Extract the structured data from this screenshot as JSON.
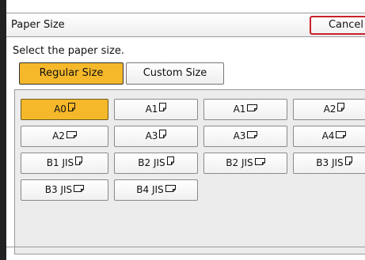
{
  "window": {
    "title": "Paper Size",
    "cancel_label": "Cancel"
  },
  "instruction": "Select the paper size.",
  "tabs": [
    {
      "label": "Regular Size",
      "active": true
    },
    {
      "label": "Custom Size",
      "active": false
    }
  ],
  "sizes": [
    {
      "label": "A0",
      "orientation": "portrait",
      "selected": true
    },
    {
      "label": "A1",
      "orientation": "portrait",
      "selected": false
    },
    {
      "label": "A1",
      "orientation": "landscape",
      "selected": false
    },
    {
      "label": "A2",
      "orientation": "portrait",
      "selected": false
    },
    {
      "label": "A2",
      "orientation": "landscape",
      "selected": false
    },
    {
      "label": "A3",
      "orientation": "portrait",
      "selected": false
    },
    {
      "label": "A3",
      "orientation": "landscape",
      "selected": false
    },
    {
      "label": "A4",
      "orientation": "landscape",
      "selected": false
    },
    {
      "label": "B1 JIS",
      "orientation": "portrait",
      "selected": false
    },
    {
      "label": "B2 JIS",
      "orientation": "portrait",
      "selected": false
    },
    {
      "label": "B2 JIS",
      "orientation": "landscape",
      "selected": false
    },
    {
      "label": "B3 JIS",
      "orientation": "portrait",
      "selected": false
    },
    {
      "label": "B3 JIS",
      "orientation": "landscape",
      "selected": false
    },
    {
      "label": "B4 JIS",
      "orientation": "landscape",
      "selected": false
    }
  ],
  "colors": {
    "selected": "#f5b82a",
    "cancel_border": "#c8202a"
  }
}
